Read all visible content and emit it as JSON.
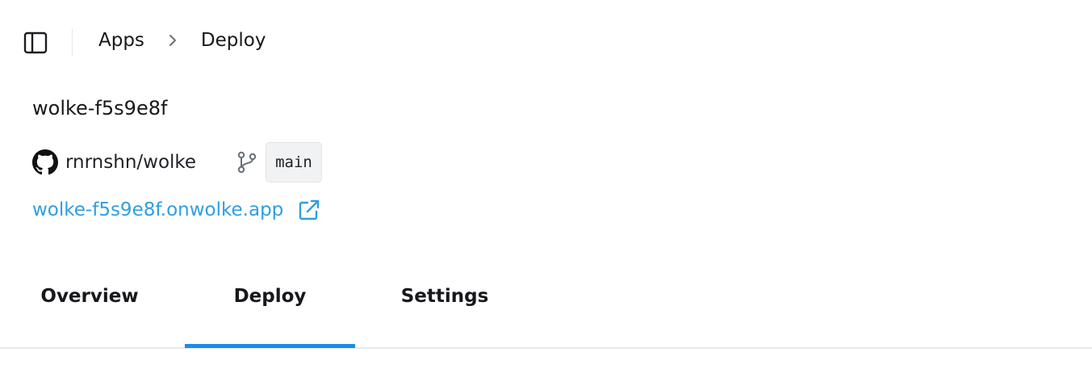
{
  "breadcrumb": {
    "items": [
      "Apps",
      "Deploy"
    ]
  },
  "app": {
    "title": "wolke-f5s9e8f",
    "repository": "rnrnshn/wolke",
    "branch": "main",
    "url": "wolke-f5s9e8f.onwolke.app"
  },
  "tabs": [
    {
      "label": "Overview",
      "active": false
    },
    {
      "label": "Deploy",
      "active": true
    },
    {
      "label": "Settings",
      "active": false
    }
  ],
  "icons": {
    "sidebar_toggle": "sidebar-panel-icon",
    "breadcrumb_separator": "chevron-right-icon",
    "repo": "github-icon",
    "branch": "git-branch-icon",
    "external_link": "external-link-icon"
  },
  "colors": {
    "link": "#2f9ee0",
    "active_tab_indicator": "#1a8fe0",
    "badge_background": "#f1f2f4",
    "text": "#16181b"
  }
}
